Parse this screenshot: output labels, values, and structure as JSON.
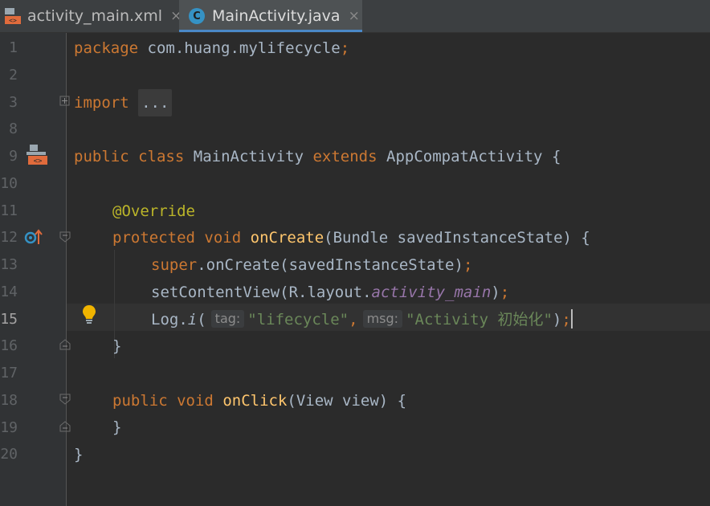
{
  "tabs": [
    {
      "label": "activity_main.xml",
      "close": "×",
      "icon": "xml-layout-icon"
    },
    {
      "label": "MainActivity.java",
      "close": "×",
      "icon": "java-class-icon",
      "active": true
    }
  ],
  "colors": {
    "background": "#2b2b2b",
    "gutter": "#313335",
    "keyword": "#cc7832",
    "annotation": "#bbb529",
    "function": "#ffc66d",
    "string": "#6a8759",
    "field": "#9876aa",
    "text": "#a9b7c6"
  },
  "line_numbers": [
    "1",
    "2",
    "3",
    "8",
    "9",
    "10",
    "11",
    "12",
    "13",
    "14",
    "15",
    "16",
    "17",
    "18",
    "19",
    "20"
  ],
  "current_line_number": "15",
  "code": {
    "l1": {
      "kw": "package",
      "rest": " com.huang.mylifecycle",
      "semi": ";"
    },
    "l3": {
      "kw": "import",
      "fold": "..."
    },
    "l9": {
      "kw1": "public",
      "kw2": "class",
      "name": "MainActivity",
      "kw3": "extends",
      "base": "AppCompatActivity",
      "brace": "{"
    },
    "l11": {
      "annotation": "@Override"
    },
    "l12": {
      "kw1": "protected",
      "kw2": "void",
      "fn": "onCreate",
      "params": "(Bundle savedInstanceState) {"
    },
    "l13": {
      "kw": "super",
      "rest": ".onCreate(savedInstanceState)",
      "semi": ";"
    },
    "l14": {
      "pre": "setContentView(R.layout.",
      "field": "activity_main",
      "post": ")",
      "semi": ";"
    },
    "l15": {
      "pre": "Log.",
      "fn": "i",
      "open": "(",
      "hint_tag": "tag:",
      "str1": "\"lifecycle\"",
      "comma": ",",
      "hint_msg": "msg:",
      "str2": "\"Activity 初始化\"",
      "close": ")",
      "semi": ";"
    },
    "l16": {
      "brace": "}"
    },
    "l18": {
      "kw1": "public",
      "kw2": "void",
      "fn": "onClick",
      "params": "(View view) {"
    },
    "l19": {
      "brace": "}"
    },
    "l20": {
      "brace": "}"
    }
  }
}
